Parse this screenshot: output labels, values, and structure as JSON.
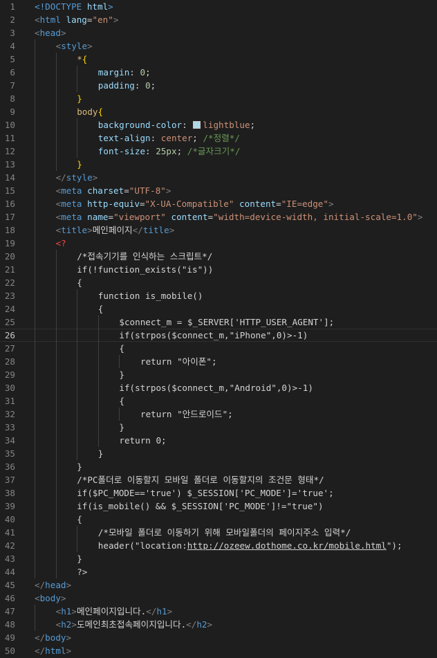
{
  "editor": {
    "language": "html",
    "active_line": 26,
    "lines": [
      {
        "n": "1",
        "indent": 0,
        "tokens": [
          {
            "t": "<!DOCTYPE ",
            "c": "tag"
          },
          {
            "t": "html",
            "c": "attr"
          },
          {
            "t": ">",
            "c": "tag"
          }
        ]
      },
      {
        "n": "2",
        "indent": 0,
        "tokens": [
          {
            "t": "<",
            "c": "punct"
          },
          {
            "t": "html",
            "c": "tag"
          },
          {
            "t": " ",
            "c": "text"
          },
          {
            "t": "lang",
            "c": "attr"
          },
          {
            "t": "=",
            "c": "text"
          },
          {
            "t": "\"en\"",
            "c": "str"
          },
          {
            "t": ">",
            "c": "punct"
          }
        ]
      },
      {
        "n": "3",
        "indent": 0,
        "tokens": [
          {
            "t": "<",
            "c": "punct"
          },
          {
            "t": "head",
            "c": "tag"
          },
          {
            "t": ">",
            "c": "punct"
          }
        ]
      },
      {
        "n": "4",
        "indent": 1,
        "tokens": [
          {
            "t": "<",
            "c": "punct"
          },
          {
            "t": "style",
            "c": "tag"
          },
          {
            "t": ">",
            "c": "punct"
          }
        ]
      },
      {
        "n": "5",
        "indent": 2,
        "tokens": [
          {
            "t": "*",
            "c": "selector"
          },
          {
            "t": "{",
            "c": "brace"
          }
        ]
      },
      {
        "n": "6",
        "indent": 3,
        "tokens": [
          {
            "t": "margin",
            "c": "prop"
          },
          {
            "t": ": ",
            "c": "text"
          },
          {
            "t": "0",
            "c": "num"
          },
          {
            "t": ";",
            "c": "text"
          }
        ]
      },
      {
        "n": "7",
        "indent": 3,
        "tokens": [
          {
            "t": "padding",
            "c": "prop"
          },
          {
            "t": ": ",
            "c": "text"
          },
          {
            "t": "0",
            "c": "num"
          },
          {
            "t": ";",
            "c": "text"
          }
        ]
      },
      {
        "n": "8",
        "indent": 2,
        "tokens": [
          {
            "t": "}",
            "c": "brace"
          }
        ]
      },
      {
        "n": "9",
        "indent": 2,
        "tokens": [
          {
            "t": "body",
            "c": "selector"
          },
          {
            "t": "{",
            "c": "brace"
          }
        ]
      },
      {
        "n": "10",
        "indent": 3,
        "tokens": [
          {
            "t": "background-color",
            "c": "prop"
          },
          {
            "t": ": ",
            "c": "text"
          },
          {
            "swatch": "#add8e6"
          },
          {
            "t": "lightblue",
            "c": "val"
          },
          {
            "t": ";",
            "c": "text"
          }
        ]
      },
      {
        "n": "11",
        "indent": 3,
        "tokens": [
          {
            "t": "text-align",
            "c": "prop"
          },
          {
            "t": ": ",
            "c": "text"
          },
          {
            "t": "center",
            "c": "val"
          },
          {
            "t": "; ",
            "c": "text"
          },
          {
            "t": "/*정렬*/",
            "c": "comment"
          }
        ]
      },
      {
        "n": "12",
        "indent": 3,
        "tokens": [
          {
            "t": "font-size",
            "c": "prop"
          },
          {
            "t": ": ",
            "c": "text"
          },
          {
            "t": "25px",
            "c": "num"
          },
          {
            "t": "; ",
            "c": "text"
          },
          {
            "t": "/*글자크기*/",
            "c": "comment"
          }
        ]
      },
      {
        "n": "13",
        "indent": 2,
        "tokens": [
          {
            "t": "}",
            "c": "brace"
          }
        ]
      },
      {
        "n": "14",
        "indent": 1,
        "tokens": [
          {
            "t": "</",
            "c": "punct"
          },
          {
            "t": "style",
            "c": "tag"
          },
          {
            "t": ">",
            "c": "punct"
          }
        ]
      },
      {
        "n": "15",
        "indent": 1,
        "tokens": [
          {
            "t": "<",
            "c": "punct"
          },
          {
            "t": "meta",
            "c": "tag"
          },
          {
            "t": " ",
            "c": "text"
          },
          {
            "t": "charset",
            "c": "attr"
          },
          {
            "t": "=",
            "c": "text"
          },
          {
            "t": "\"UTF-8\"",
            "c": "str"
          },
          {
            "t": ">",
            "c": "punct"
          }
        ]
      },
      {
        "n": "16",
        "indent": 1,
        "tokens": [
          {
            "t": "<",
            "c": "punct"
          },
          {
            "t": "meta",
            "c": "tag"
          },
          {
            "t": " ",
            "c": "text"
          },
          {
            "t": "http-equiv",
            "c": "attr"
          },
          {
            "t": "=",
            "c": "text"
          },
          {
            "t": "\"X-UA-Compatible\"",
            "c": "str"
          },
          {
            "t": " ",
            "c": "text"
          },
          {
            "t": "content",
            "c": "attr"
          },
          {
            "t": "=",
            "c": "text"
          },
          {
            "t": "\"IE=edge\"",
            "c": "str"
          },
          {
            "t": ">",
            "c": "punct"
          }
        ]
      },
      {
        "n": "17",
        "indent": 1,
        "tokens": [
          {
            "t": "<",
            "c": "punct"
          },
          {
            "t": "meta",
            "c": "tag"
          },
          {
            "t": " ",
            "c": "text"
          },
          {
            "t": "name",
            "c": "attr"
          },
          {
            "t": "=",
            "c": "text"
          },
          {
            "t": "\"viewport\"",
            "c": "str"
          },
          {
            "t": " ",
            "c": "text"
          },
          {
            "t": "content",
            "c": "attr"
          },
          {
            "t": "=",
            "c": "text"
          },
          {
            "t": "\"width=device-width, initial-scale=1.0\"",
            "c": "str"
          },
          {
            "t": ">",
            "c": "punct"
          }
        ]
      },
      {
        "n": "18",
        "indent": 1,
        "tokens": [
          {
            "t": "<",
            "c": "punct"
          },
          {
            "t": "title",
            "c": "tag"
          },
          {
            "t": ">",
            "c": "punct"
          },
          {
            "t": "메인페이지",
            "c": "text"
          },
          {
            "t": "</",
            "c": "punct"
          },
          {
            "t": "title",
            "c": "tag"
          },
          {
            "t": ">",
            "c": "punct"
          }
        ]
      },
      {
        "n": "19",
        "indent": 1,
        "tokens": [
          {
            "t": "<?",
            "c": "phptag"
          }
        ]
      },
      {
        "n": "20",
        "indent": 2,
        "tokens": [
          {
            "t": "/*접속기기를 인식하는 스크립트*/",
            "c": "php"
          }
        ]
      },
      {
        "n": "21",
        "indent": 2,
        "tokens": [
          {
            "t": "if(!function_exists(\"is\"))",
            "c": "php"
          }
        ]
      },
      {
        "n": "22",
        "indent": 2,
        "tokens": [
          {
            "t": "{",
            "c": "php"
          }
        ]
      },
      {
        "n": "23",
        "indent": 3,
        "tokens": [
          {
            "t": "function is_mobile()",
            "c": "php"
          }
        ]
      },
      {
        "n": "24",
        "indent": 3,
        "tokens": [
          {
            "t": "{",
            "c": "php"
          }
        ]
      },
      {
        "n": "25",
        "indent": 4,
        "tokens": [
          {
            "t": "$connect_m = $_SERVER['HTTP_USER_AGENT'];",
            "c": "php"
          }
        ]
      },
      {
        "n": "26",
        "indent": 4,
        "tokens": [
          {
            "t": "if(strpos($connect_m,\"iPhone\",0)>-1)",
            "c": "php"
          }
        ]
      },
      {
        "n": "27",
        "indent": 4,
        "tokens": [
          {
            "t": "{",
            "c": "php"
          }
        ]
      },
      {
        "n": "28",
        "indent": 5,
        "tokens": [
          {
            "t": "return \"아이폰\";",
            "c": "php"
          }
        ]
      },
      {
        "n": "29",
        "indent": 4,
        "tokens": [
          {
            "t": "}",
            "c": "php"
          }
        ]
      },
      {
        "n": "30",
        "indent": 4,
        "tokens": [
          {
            "t": "if(strpos($connect_m,\"Android\",0)>-1)",
            "c": "php"
          }
        ]
      },
      {
        "n": "31",
        "indent": 4,
        "tokens": [
          {
            "t": "{",
            "c": "php"
          }
        ]
      },
      {
        "n": "32",
        "indent": 5,
        "tokens": [
          {
            "t": "return \"안드로이드\";",
            "c": "php"
          }
        ]
      },
      {
        "n": "33",
        "indent": 4,
        "tokens": [
          {
            "t": "}",
            "c": "php"
          }
        ]
      },
      {
        "n": "34",
        "indent": 4,
        "tokens": [
          {
            "t": "return 0;",
            "c": "php"
          }
        ]
      },
      {
        "n": "35",
        "indent": 3,
        "tokens": [
          {
            "t": "}",
            "c": "php"
          }
        ]
      },
      {
        "n": "36",
        "indent": 2,
        "tokens": [
          {
            "t": "}",
            "c": "php"
          }
        ]
      },
      {
        "n": "37",
        "indent": 2,
        "tokens": [
          {
            "t": "/*PC폴더로 이동할지 모바일 폴더로 이동할지의 조건문 형태*/",
            "c": "php"
          }
        ]
      },
      {
        "n": "38",
        "indent": 2,
        "tokens": [
          {
            "t": "if($PC_MODE=='true') $_SESSION['PC_MODE']='true';",
            "c": "php"
          }
        ]
      },
      {
        "n": "39",
        "indent": 2,
        "tokens": [
          {
            "t": "if(is_mobile() && $_SESSION['PC_MODE']!=\"true\")",
            "c": "php"
          }
        ]
      },
      {
        "n": "40",
        "indent": 2,
        "tokens": [
          {
            "t": "{",
            "c": "php"
          }
        ]
      },
      {
        "n": "41",
        "indent": 3,
        "tokens": [
          {
            "t": "/*모바일 폴더로 이동하기 위해 모바일폴더의 페이지주소 입력*/",
            "c": "php"
          }
        ]
      },
      {
        "n": "42",
        "indent": 3,
        "tokens": [
          {
            "t": "header(\"location:",
            "c": "php"
          },
          {
            "t": "http://ozeew.dothome.co.kr/mobile.html",
            "c": "link"
          },
          {
            "t": "\");",
            "c": "php"
          }
        ]
      },
      {
        "n": "43",
        "indent": 2,
        "tokens": [
          {
            "t": "}",
            "c": "php"
          }
        ]
      },
      {
        "n": "44",
        "indent": 2,
        "tokens": [
          {
            "t": "?>",
            "c": "php"
          }
        ]
      },
      {
        "n": "45",
        "indent": 0,
        "tokens": [
          {
            "t": "</",
            "c": "punct"
          },
          {
            "t": "head",
            "c": "tag"
          },
          {
            "t": ">",
            "c": "punct"
          }
        ]
      },
      {
        "n": "46",
        "indent": 0,
        "tokens": [
          {
            "t": "<",
            "c": "punct"
          },
          {
            "t": "body",
            "c": "tag"
          },
          {
            "t": ">",
            "c": "punct"
          }
        ]
      },
      {
        "n": "47",
        "indent": 1,
        "tokens": [
          {
            "t": "<",
            "c": "punct"
          },
          {
            "t": "h1",
            "c": "tag"
          },
          {
            "t": ">",
            "c": "punct"
          },
          {
            "t": "메인페이지입니다.",
            "c": "text"
          },
          {
            "t": "</",
            "c": "punct"
          },
          {
            "t": "h1",
            "c": "tag"
          },
          {
            "t": ">",
            "c": "punct"
          }
        ]
      },
      {
        "n": "48",
        "indent": 1,
        "tokens": [
          {
            "t": "<",
            "c": "punct"
          },
          {
            "t": "h2",
            "c": "tag"
          },
          {
            "t": ">",
            "c": "punct"
          },
          {
            "t": "도메인최초접속페이지입니다.",
            "c": "text"
          },
          {
            "t": "</",
            "c": "punct"
          },
          {
            "t": "h2",
            "c": "tag"
          },
          {
            "t": ">",
            "c": "punct"
          }
        ]
      },
      {
        "n": "49",
        "indent": 0,
        "tokens": [
          {
            "t": "</",
            "c": "punct"
          },
          {
            "t": "body",
            "c": "tag"
          },
          {
            "t": ">",
            "c": "punct"
          }
        ]
      },
      {
        "n": "50",
        "indent": 0,
        "tokens": [
          {
            "t": "</",
            "c": "punct"
          },
          {
            "t": "html",
            "c": "tag"
          },
          {
            "t": ">",
            "c": "punct"
          }
        ]
      }
    ]
  }
}
